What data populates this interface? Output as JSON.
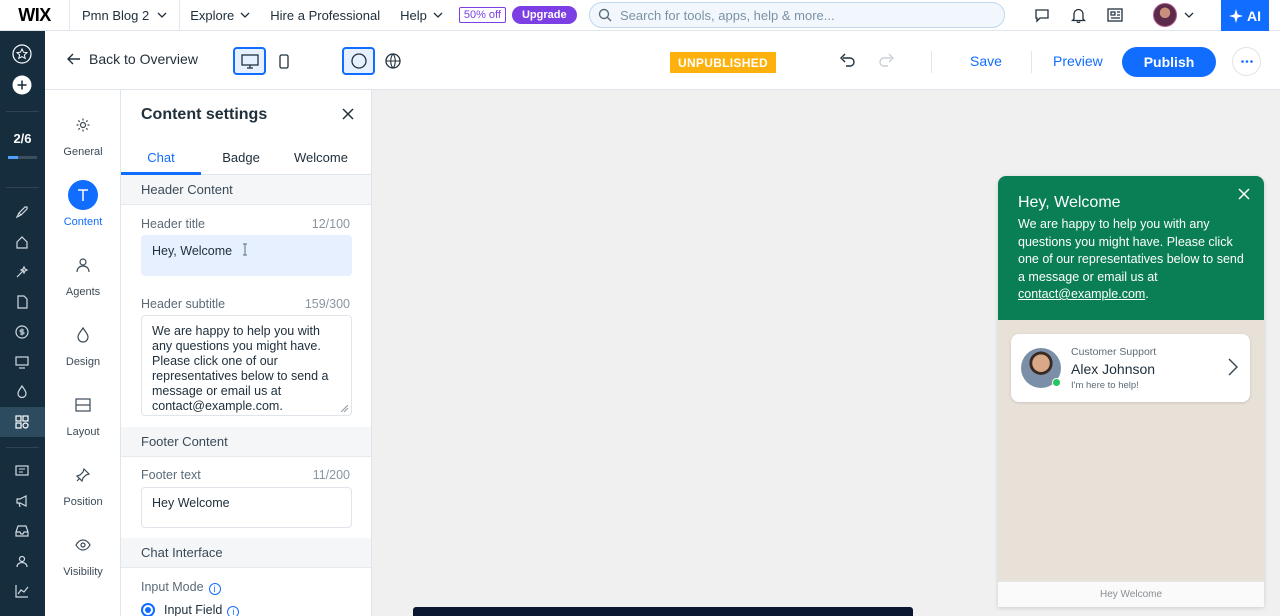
{
  "app": {
    "logo": "WIX",
    "site_name": "Pmn Blog 2",
    "menu": [
      {
        "label": "Explore"
      },
      {
        "label": "Hire a Professional"
      },
      {
        "label": "Help"
      }
    ],
    "discount_badge": "50% off",
    "upgrade_label": "Upgrade",
    "search_placeholder": "Search for tools, apps, help & more...",
    "ai_label": "AI"
  },
  "toolbar": {
    "back_label": "Back to Overview",
    "status": "UNPUBLISHED",
    "save_label": "Save",
    "preview_label": "Preview",
    "publish_label": "Publish"
  },
  "rail": {
    "progress_text": "2/6",
    "progress_fraction": 0.33
  },
  "side_tabs": [
    {
      "label": "General",
      "icon": "gear-icon"
    },
    {
      "label": "Content",
      "icon": "text-icon"
    },
    {
      "label": "Agents",
      "icon": "agents-icon"
    },
    {
      "label": "Design",
      "icon": "design-icon"
    },
    {
      "label": "Layout",
      "icon": "layout-icon"
    },
    {
      "label": "Position",
      "icon": "pin-icon"
    },
    {
      "label": "Visibility",
      "icon": "eye-icon"
    }
  ],
  "panel": {
    "title": "Content settings",
    "tabs": [
      "Chat",
      "Badge",
      "Welcome"
    ],
    "header_section": "Header Content",
    "header_title_label": "Header title",
    "header_title_count": "12/100",
    "header_title_value": "Hey, Welcome",
    "header_subtitle_label": "Header subtitle",
    "header_subtitle_count": "159/300",
    "header_subtitle_value": "We are happy to help you with any questions you might have. Please click one of our representatives below to send a message or email us at contact@example.com.",
    "footer_section": "Footer Content",
    "footer_text_label": "Footer text",
    "footer_text_count": "11/200",
    "footer_text_value": "Hey Welcome",
    "chat_interface_section": "Chat Interface",
    "input_mode_label": "Input Mode",
    "input_field_label": "Input Field"
  },
  "chat_widget": {
    "title": "Hey, Welcome",
    "subtitle_text": "We are happy to help you with any questions you might have. Please click one of our representatives below to send a message or email us at",
    "email": "contact@example.com",
    "agent_role": "Customer Support",
    "agent_name": "Alex Johnson",
    "agent_message": "I'm here to help!",
    "footer": "Hey Welcome"
  },
  "colors": {
    "accent": "#116dff",
    "chat_header": "#0a7f56",
    "status_badge": "#fdb10c",
    "upgrade": "#7b3fe4"
  }
}
